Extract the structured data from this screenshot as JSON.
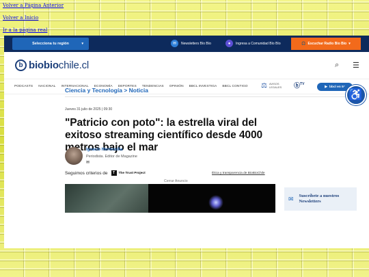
{
  "top_links": [
    "Volver a Página Anterior",
    "Volver a Inicio",
    "Ir a la página real"
  ],
  "topbar": {
    "region_button": "Selecciona tu región",
    "newsletters": "Newsletters Bío Bío",
    "comunidad": "Ingresa a Comunidad Bío Bío",
    "radio_button": "Escuchar Radio Bío Bío"
  },
  "logo": {
    "name": "biobio",
    "domain": "chile.cl",
    "mark": "b"
  },
  "nav": {
    "items": [
      "PODCASTS",
      "NACIONAL",
      "INTERNACIONAL",
      "ECONOMÍA",
      "DEPORTES",
      "TENDENCIAS",
      "OPINIÓN",
      "BBCL INVESTIGA",
      "BBCL CONTIGO"
    ],
    "avisos_legales": "AVISOS LEGALES",
    "tv_logo": "TV",
    "en_vivo": "bbcl en 5°"
  },
  "breadcrumb": "Ciencia y Tecnología > Noticia",
  "article": {
    "date": "Jueves 31 julio de 2025 | 09:30",
    "headline": "\"Patricio con poto\": la estrella viral del exitoso streaming científico desde 4000 metros bajo el mar",
    "author_name": "Ignacio Hermosilla",
    "author_role": "Periodista. Editor de Magazine",
    "criteria_prefix": "Seguimos criterios de",
    "trust_project": "The Trust Project",
    "ethics_link": "Ética y transparencia de BioBioChile"
  },
  "ad": {
    "close_label": "Cerrar Anuncio"
  },
  "newsletter_card": {
    "text": "Suscríbete a nuestros Newsletters"
  },
  "icons": {
    "search": "search-icon",
    "menu": "menu-icon",
    "accessibility": "accessibility-icon"
  },
  "colors": {
    "navy": "#0d2a5c",
    "accent_blue": "#1f66b8",
    "orange": "#f26a1b"
  }
}
